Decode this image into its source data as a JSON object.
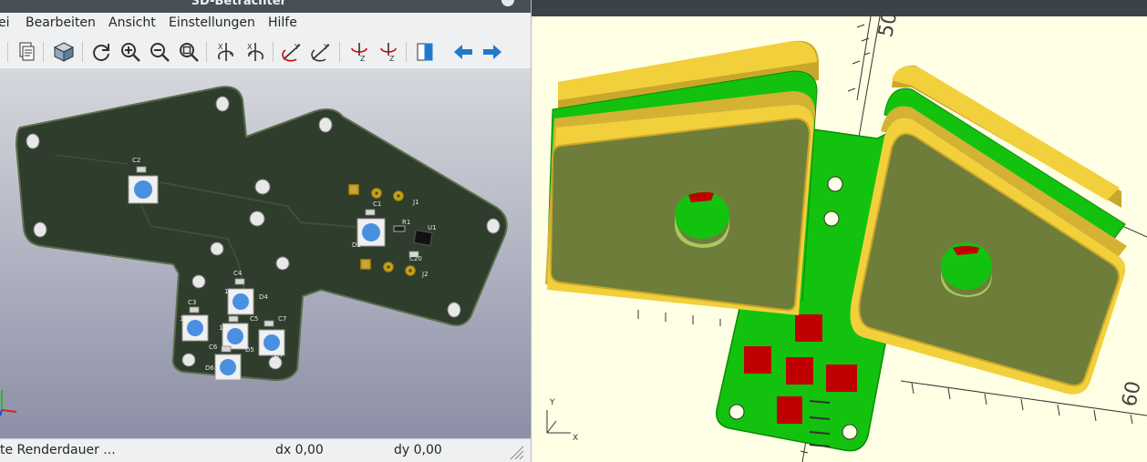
{
  "left_window": {
    "title": "3D-Betrachter",
    "menu": [
      "ei",
      "Bearbeiten",
      "Ansicht",
      "Einstellungen",
      "Hilfe"
    ],
    "toolbar_icons": [
      "copy-icon",
      "board-3d-icon",
      "reload-icon",
      "zoom-in-icon",
      "zoom-out-icon",
      "zoom-fit-icon",
      "rotate-x-icon",
      "rotate-x-reverse-icon",
      "rotate-y-icon",
      "rotate-y-reverse-icon",
      "rotate-z-icon",
      "rotate-z-reverse-icon",
      "flip-board-icon",
      "arrow-left-icon",
      "arrow-right-icon"
    ],
    "status": {
      "message": "te Renderdauer ...",
      "dx": "dx 0,00",
      "dy": "dy 0,00"
    },
    "board": {
      "designators": {
        "c2": "C2",
        "c1": "C1",
        "d1": "D1",
        "r1": "R1",
        "u1": "U1",
        "j1": "J1",
        "j2": "J2",
        "c20": "C20",
        "c4": "C4",
        "d4": "D4",
        "c3": "C3",
        "c5": "C5",
        "c7": "C7",
        "c6": "C6",
        "d6": "D6",
        "d5": "D5",
        "d7": "D7",
        "one_a": "1",
        "one_b": "1",
        "one_c": "1"
      }
    },
    "colors": {
      "board": "#2e3d2c",
      "led": "#4a90e2",
      "toolbar_blue": "#1f7acc"
    }
  },
  "right_window": {
    "axis_labels": {
      "y": "Y",
      "x": "X"
    },
    "scale_labels": [
      "60",
      "50"
    ],
    "colors": {
      "yellow": "#f2d03c",
      "green": "#13c20e",
      "panel": "#6f7d3a",
      "red": "#c00000"
    }
  }
}
